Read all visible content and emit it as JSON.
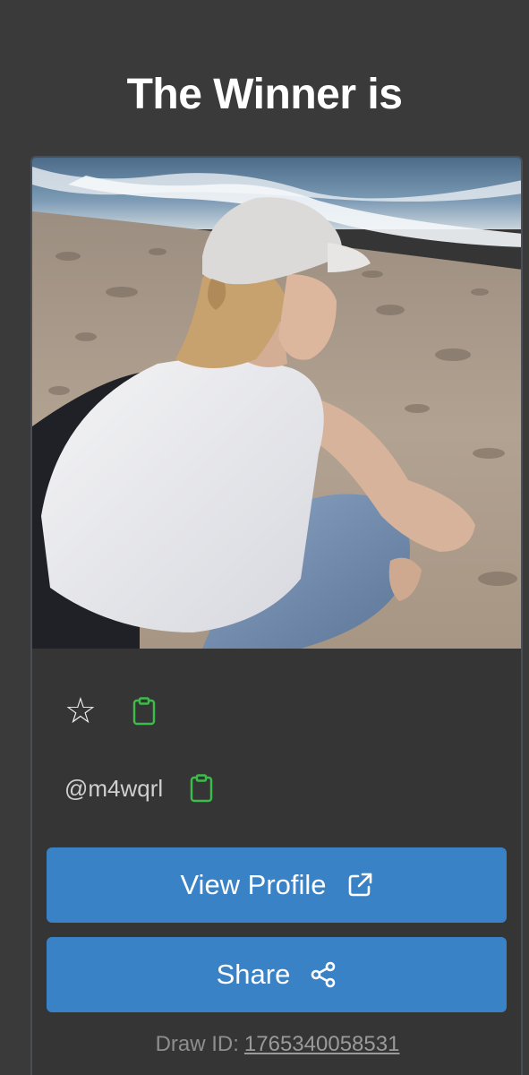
{
  "header": {
    "title": "The Winner is"
  },
  "winner": {
    "username": "@m4wqrl",
    "star_icon": "star-outline-icon",
    "copy_icon": "clipboard-icon"
  },
  "actions": {
    "view_profile_label": "View Profile",
    "view_profile_icon": "external-link-icon",
    "share_label": "Share",
    "share_icon": "share-icon"
  },
  "footer": {
    "draw_id_label": "Draw ID:",
    "draw_id_value": "1765340058531"
  },
  "colors": {
    "background": "#3a3a3a",
    "button": "#3a82c6",
    "clipboard": "#3dbb4b"
  }
}
